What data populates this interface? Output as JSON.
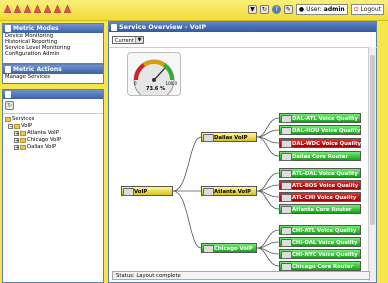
{
  "header": {
    "user_label": "User:",
    "user_name": "admin",
    "logout_label": "Logout",
    "icons": [
      "nav-icon-1",
      "nav-icon-2",
      "nav-icon-3",
      "nav-icon-4",
      "nav-icon-5",
      "nav-icon-6",
      "nav-icon-7"
    ]
  },
  "metric_modes": {
    "title": "Metric Modes",
    "items": [
      "Device Monitoring",
      "Historical Reporting",
      "Service Level Monitoring",
      "Configuration Admin"
    ]
  },
  "metric_actions": {
    "title": "Metric Actions",
    "items": [
      "Manage Services"
    ]
  },
  "tree": {
    "root": "Services",
    "voip": "VoIP",
    "children": [
      "Atlanta VoIP",
      "Chicago VoIP",
      "Dallas VoIP"
    ]
  },
  "main": {
    "title": "Service Overview - VoIP",
    "select_value": "Current",
    "status": "Status: Layout complete"
  },
  "gauge": {
    "value_label": "73.6 %",
    "value_percent": 73.6,
    "min_label": "0",
    "max_label": "100.0"
  },
  "graph": {
    "root": {
      "label": "VoIP",
      "status": "yellow"
    },
    "dallas": {
      "label": "Dallas VoIP",
      "status": "yellow"
    },
    "atlanta": {
      "label": "Atlanta VoIP",
      "status": "yellow"
    },
    "chicago": {
      "label": "Chicago VoIP",
      "status": "green"
    },
    "dallas_leaves": [
      {
        "label": "DAL-ATL Voice Quality",
        "status": "green"
      },
      {
        "label": "DAL-HOU Voice Quality",
        "status": "green"
      },
      {
        "label": "DAL-WDC Voice Quality",
        "status": "red"
      },
      {
        "label": "Dallas Core Router",
        "status": "green"
      }
    ],
    "atlanta_leaves": [
      {
        "label": "ATL-DAL Voice Quality",
        "status": "green"
      },
      {
        "label": "ATL-BOS Voice Quality",
        "status": "red"
      },
      {
        "label": "ATL-CHI Voice Quality",
        "status": "red"
      },
      {
        "label": "Atlanta Core Router",
        "status": "green"
      }
    ],
    "chicago_leaves": [
      {
        "label": "CHI-ATL Voice Quality",
        "status": "green"
      },
      {
        "label": "CHI-DAL Voice Quality",
        "status": "green"
      },
      {
        "label": "CHI-NYC Voice Quality",
        "status": "green"
      },
      {
        "label": "Chicago Core Router",
        "status": "green"
      }
    ]
  },
  "colors": {
    "header_blue": "#3c62a8",
    "status_green": "#10a810",
    "status_red": "#a00000",
    "status_yellow": "#d8c21a",
    "background_yellow": "#f6e64a"
  }
}
